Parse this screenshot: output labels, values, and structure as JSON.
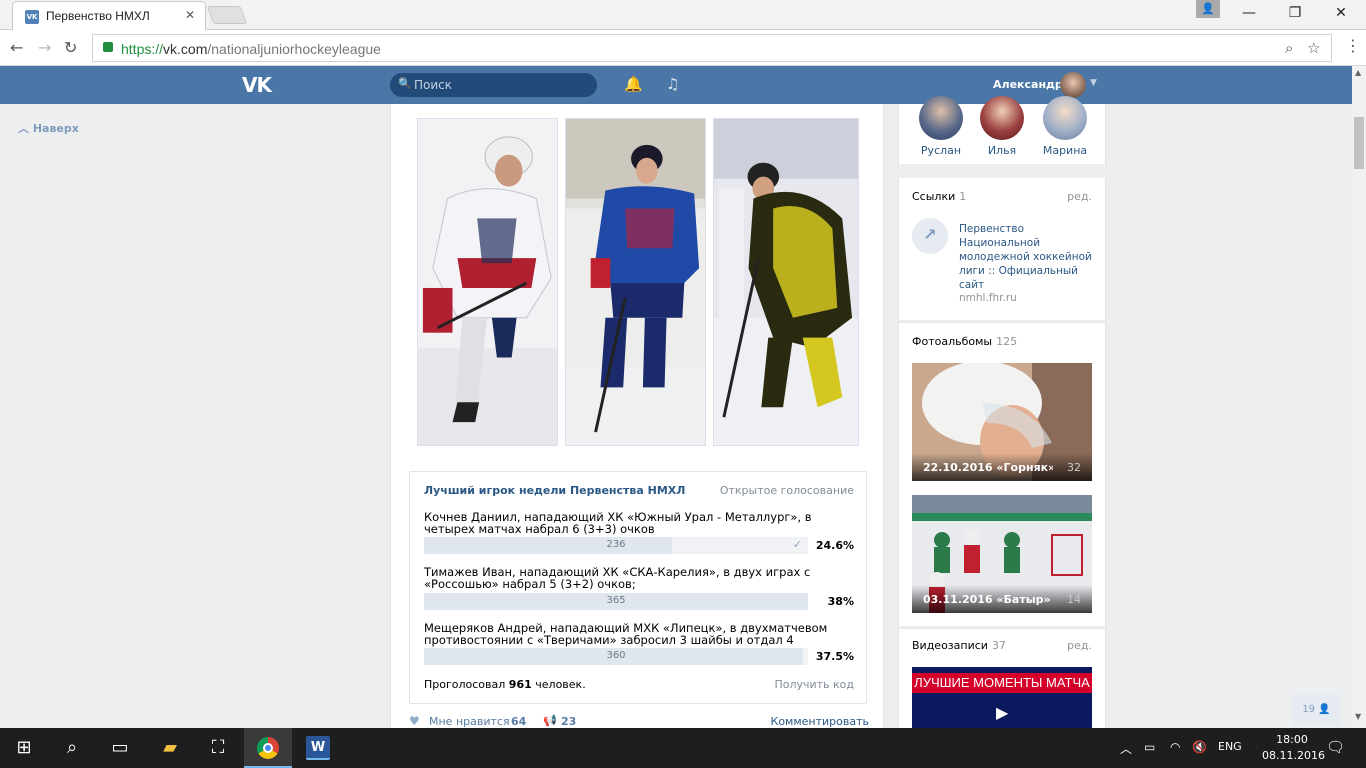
{
  "browser": {
    "tab_title": "Первенство НМХЛ",
    "tab_close": "✕",
    "url_protocol": "https://",
    "url_host": "vk.com",
    "url_path": "/nationaljuniorhockeyleague",
    "win_min": "—",
    "win_max": "❐",
    "win_close": "✕"
  },
  "header": {
    "logo": "VK",
    "search_placeholder": "Поиск",
    "user_name": "Александр"
  },
  "sidebar": {
    "to_top": "Наверх"
  },
  "poll": {
    "title": "Лучший игрок недели Первенства НМХЛ",
    "type": "Открытое голосование",
    "options": [
      {
        "text": "Кочнев Даниил, нападающий ХК «Южный Урал - Металлург», в четырех матчах набрал 6 (3+3) очков",
        "votes": "236",
        "percent": "24.6%",
        "share": 0.646,
        "voted": true
      },
      {
        "text": "Тимажев Иван, нападающий ХК «СКА-Карелия», в двух играх с «Россошью» набрал 5 (3+2) очков;",
        "votes": "365",
        "percent": "38%",
        "share": 1.0,
        "voted": false
      },
      {
        "text": "Мещеряков Андрей, нападающий МХК «Липецк», в двухматчевом противостоянии с «Тверичами» забросил 3 шайбы и отдал 4 передачи",
        "votes": "360",
        "percent": "37.5%",
        "share": 0.986,
        "voted": false
      }
    ],
    "voted_prefix": "Проголосовал",
    "voted_count": "961",
    "voted_suffix": "человек.",
    "get_code": "Получить код"
  },
  "actions": {
    "like_label": "Мне нравится",
    "like_count": "64",
    "share_count": "23",
    "comment_label": "Комментировать"
  },
  "friends": [
    {
      "name": "Руслан"
    },
    {
      "name": "Илья"
    },
    {
      "name": "Марина"
    }
  ],
  "links": {
    "header": "Ссылки",
    "count": "1",
    "edit": "ред.",
    "title": "Первенство Национальной молодежной хоккейной лиги :: Официальный сайт",
    "url": "nmhl.fhr.ru"
  },
  "albums": {
    "header": "Фотоальбомы",
    "count": "125",
    "items": [
      {
        "title": "22.10.2016 «Горняк» - «...",
        "count": "32"
      },
      {
        "title": "03.11.2016 «Батыр» - «П...",
        "count": "14"
      }
    ]
  },
  "videos": {
    "header": "Видеозаписи",
    "count": "37",
    "edit": "ред.",
    "thumb_title": "ЛУЧШИЕ МОМЕНТЫ МАТЧА"
  },
  "online_badge": "19",
  "taskbar": {
    "lang": "ENG",
    "time": "18:00",
    "date": "08.11.2016"
  }
}
